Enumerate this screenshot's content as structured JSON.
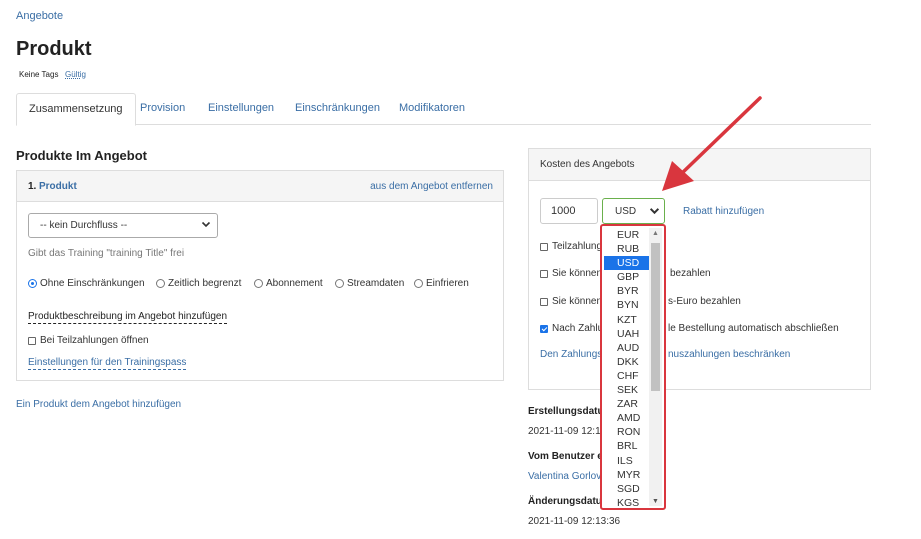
{
  "breadcrumb": "Angebote",
  "page_title": "Produkt",
  "tags_label": "Keine Tags",
  "status_label": "Gültig",
  "tabs": [
    {
      "label": "Zusammensetzung"
    },
    {
      "label": "Provision"
    },
    {
      "label": "Einstellungen"
    },
    {
      "label": "Einschränkungen"
    },
    {
      "label": "Modifikatoren"
    }
  ],
  "products_section_title": "Produkte Im Angebot",
  "product": {
    "number": "1.",
    "name": "Produkt",
    "remove_label": "aus dem Angebot entfernen",
    "flow_select_value": "-- kein Durchfluss --",
    "hint": "Gibt das Training \"training Title\" frei",
    "access_options": [
      {
        "label": "Ohne Einschränkungen",
        "selected": true
      },
      {
        "label": "Zeitlich begrenzt",
        "selected": false
      },
      {
        "label": "Abonnement",
        "selected": false
      },
      {
        "label": "Streamdaten",
        "selected": false
      },
      {
        "label": "Einfrieren",
        "selected": false
      }
    ],
    "description_link": "Produktbeschreibung im Angebot hinzufügen",
    "open_on_partial_label": "Bei Teilzahlungen öffnen",
    "pass_settings_link": "Einstellungen für den Trainingspass"
  },
  "add_product_link": "Ein Produkt dem Angebot hinzufügen",
  "cost": {
    "title": "Kosten des Angebots",
    "amount": "1000",
    "currency_value": "USD",
    "discount_link": "Rabatt hinzufügen",
    "options": [
      {
        "visible_start": "Teilzahlung",
        "visible_end": "",
        "checked": false
      },
      {
        "visible_start": "Sie können",
        "visible_end": "bezahlen",
        "checked": false
      },
      {
        "visible_start": "Sie können",
        "visible_end": "s-Euro bezahlen",
        "checked": false
      },
      {
        "visible_start": "Nach Zahlu",
        "visible_end": "le Bestellung automatisch abschließen",
        "checked": true
      }
    ],
    "limit_link_start": "Den Zahlungs",
    "limit_link_end": "nuszahlungen beschränken"
  },
  "meta": {
    "created_label": "Erstellungsdatu",
    "created_value": "2021-11-09 12:13:",
    "created_by_label": "Vom Benutzer e",
    "created_by_value": "Valentina Gorlov",
    "changed_label": "Änderungsdatu",
    "changed_value": "2021-11-09 12:13:36"
  },
  "currency_options": [
    "EUR",
    "RUB",
    "USD",
    "GBP",
    "BYR",
    "BYN",
    "KZT",
    "UAH",
    "AUD",
    "DKK",
    "CHF",
    "SEK",
    "ZAR",
    "AMD",
    "RON",
    "BRL",
    "ILS",
    "MYR",
    "SGD",
    "KGS"
  ],
  "currency_selected_index": 2,
  "colors": {
    "link": "#3a6ea5",
    "highlight_red": "#d9363e",
    "selection_blue": "#1a73e8",
    "input_focus_green": "#6ab04c"
  }
}
